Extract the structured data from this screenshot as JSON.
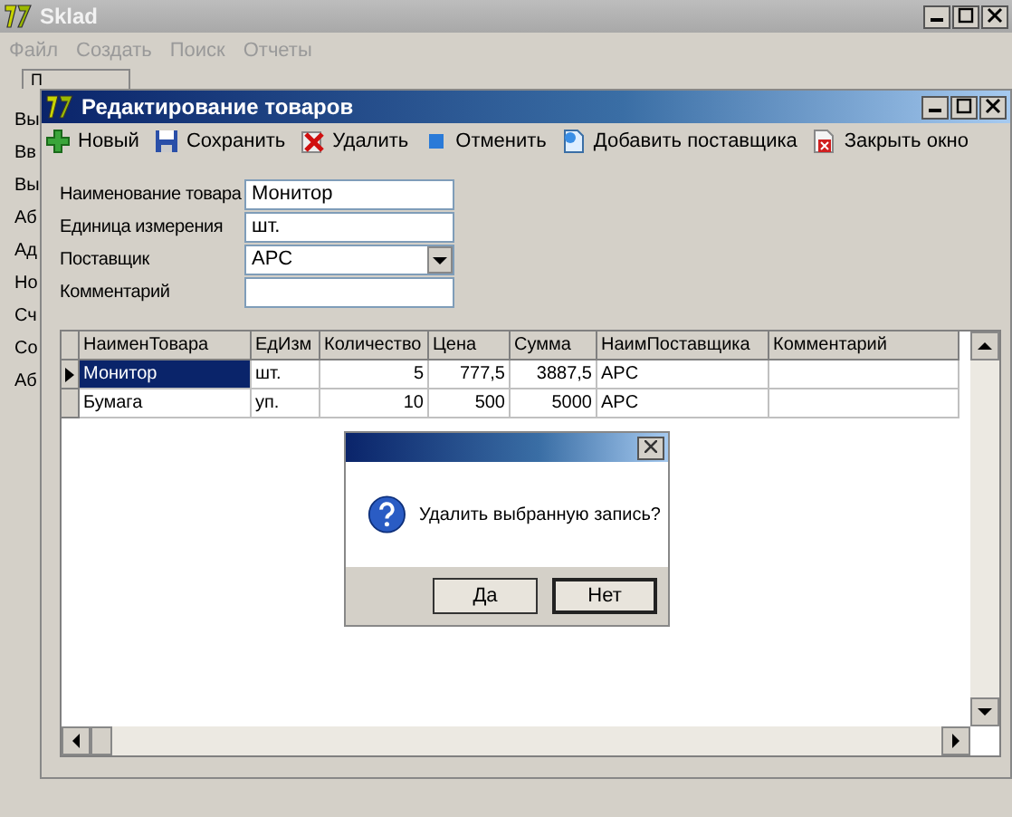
{
  "main_window": {
    "title": "Sklad",
    "menu": [
      "Файл",
      "Создать",
      "Поиск",
      "Отчеты"
    ],
    "tabs": [
      "П"
    ],
    "side_items": [
      "Вы",
      "Вв",
      "Вы",
      "Аб",
      "Ад",
      "Но",
      "Сч",
      "Со",
      "Аб"
    ]
  },
  "editor": {
    "title": "Редактирование товаров",
    "toolbar": [
      "Новый",
      "Сохранить",
      "Удалить",
      "Отменить",
      "Добавить поставщика",
      "Закрыть окно"
    ],
    "fields": [
      {
        "label": "Наименование товара",
        "kind": "text",
        "value": "Монитор"
      },
      {
        "label": "Единица измерения",
        "kind": "text",
        "value": "шт."
      },
      {
        "label": "Поставщик",
        "kind": "combo",
        "value": "APC"
      },
      {
        "label": "Комментарий",
        "kind": "text"
      }
    ],
    "grid": {
      "columns": [
        "НаименТовара",
        "ЕдИзм",
        "Количество",
        "Цена",
        "Сумма",
        "НаимПоставщика",
        "Комментарий"
      ],
      "rows": [
        {
          "selected": true,
          "cells": [
            "Монитор",
            "шт.",
            "5",
            "777,5",
            "3887,5",
            "APC",
            ""
          ]
        },
        {
          "selected": false,
          "cells": [
            "Бумага",
            "уп.",
            "10",
            "500",
            "5000",
            "APC",
            ""
          ]
        }
      ]
    }
  },
  "dialog": {
    "message": "Удалить выбранную запись?",
    "buttons": [
      "Да",
      "Нет"
    ]
  }
}
